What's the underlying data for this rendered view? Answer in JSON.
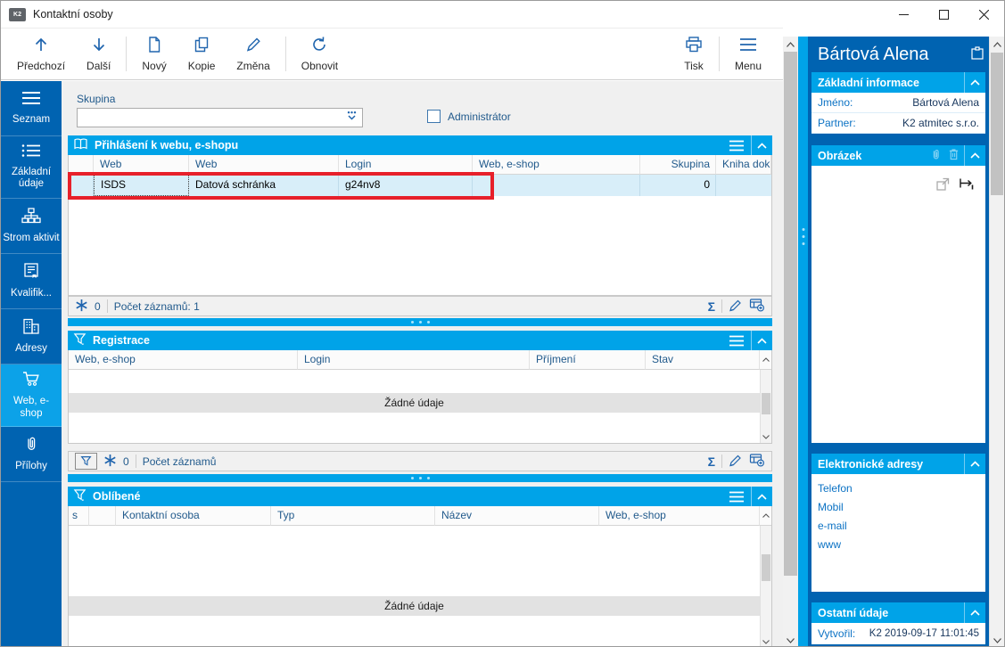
{
  "window": {
    "title": "Kontaktní osoby",
    "app_badge": "K2"
  },
  "toolbar": {
    "prev": "Předchozí",
    "next": "Další",
    "new": "Nový",
    "copy": "Kopie",
    "change": "Změna",
    "refresh": "Obnovit",
    "print": "Tisk",
    "menu": "Menu"
  },
  "sidebar": {
    "items": [
      {
        "label": "Seznam"
      },
      {
        "label": "Základní údaje"
      },
      {
        "label": "Strom aktivit"
      },
      {
        "label": "Kvalifik..."
      },
      {
        "label": "Adresy"
      },
      {
        "label": "Web, e-shop"
      },
      {
        "label": "Přílohy"
      }
    ]
  },
  "filter": {
    "group_label": "Skupina",
    "group_value": "",
    "admin_label": "Administrátor"
  },
  "login_panel": {
    "title": "Přihlášení k webu, e-shopu",
    "columns": {
      "c1": "Web",
      "c2": "Web",
      "c3": "Login",
      "c4": "Web, e-shop",
      "c5": "Skupina",
      "c6": "Kniha dokl"
    },
    "row": {
      "web1": "ISDS",
      "web2": "Datová schránka",
      "login": "g24nv8",
      "webshop": "",
      "group": "0",
      "book": ""
    },
    "footer": {
      "count": "0",
      "records": "Počet záznamů: 1"
    }
  },
  "registration_panel": {
    "title": "Registrace",
    "columns": {
      "c1": "Web, e-shop",
      "c2": "Login",
      "c3": "Příjmení",
      "c4": "Stav"
    },
    "empty": "Žádné údaje",
    "footer": {
      "count": "0",
      "records": "Počet záznamů"
    }
  },
  "favorites_panel": {
    "title": "Oblíbené",
    "columns": {
      "c1": "s",
      "c2": "",
      "c3": "Kontaktní osoba",
      "c4": "Typ",
      "c5": "Název",
      "c6": "Web, e-shop"
    },
    "empty": "Žádné údaje"
  },
  "detail": {
    "title": "Bártová Alena",
    "basic": {
      "title": "Základní informace",
      "name_label": "Jméno:",
      "name_value": "Bártová Alena",
      "partner_label": "Partner:",
      "partner_value": "K2 atmitec s.r.o."
    },
    "image": {
      "title": "Obrázek"
    },
    "addresses": {
      "title": "Elektronické adresy",
      "links": [
        "Telefon",
        "Mobil",
        "e-mail",
        "www"
      ]
    },
    "other": {
      "title": "Ostatní údaje",
      "created_label": "Vytvořil:",
      "created_value": "K2 2019-09-17 11:01:45"
    }
  },
  "icons": {
    "sum": "Σ"
  },
  "colors": {
    "accent_dark": "#0063B1",
    "accent_bright": "#00A3E8",
    "toolbar_icon": "#2065AE",
    "selection": "#D8EEF9",
    "annotation_red": "#E7202A"
  }
}
